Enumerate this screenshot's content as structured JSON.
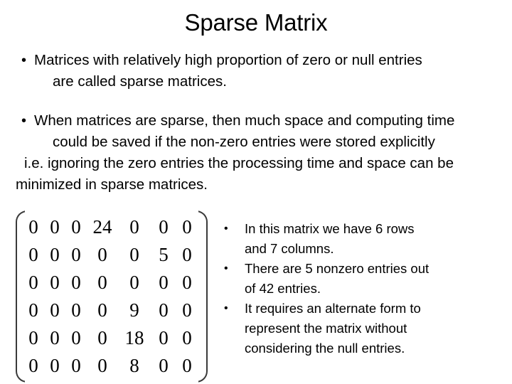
{
  "slide": {
    "title": "Sparse Matrix",
    "background_color": "#ffffff",
    "text_color": "#000000",
    "bracket_color": "#3a3a3a"
  },
  "paragraphs": [
    {
      "bullet": "•",
      "lines": [
        "Matrices with relatively high proportion of zero or null entries",
        "are called sparse matrices."
      ]
    },
    {
      "bullet": "•",
      "lines": [
        "When matrices are sparse, then much space and computing time",
        "could be saved if the non-zero entries were stored explicitly",
        "i.e. ignoring the zero entries the processing time and space can be",
        "minimized in sparse matrices."
      ]
    }
  ],
  "matrix": {
    "rows": 6,
    "cols": 7,
    "values": [
      [
        "0",
        "0",
        "0",
        "24",
        "0",
        "0",
        "0"
      ],
      [
        "0",
        "0",
        "0",
        "0",
        "0",
        "5",
        "0"
      ],
      [
        "0",
        "0",
        "0",
        "0",
        "0",
        "0",
        "0"
      ],
      [
        "0",
        "0",
        "0",
        "0",
        "9",
        "0",
        "0"
      ],
      [
        "0",
        "0",
        "0",
        "0",
        "18",
        "0",
        "0"
      ],
      [
        "0",
        "0",
        "0",
        "0",
        "8",
        "0",
        "0"
      ]
    ]
  },
  "notes": {
    "bullet": "•",
    "items": [
      {
        "lines": [
          "In this matrix we have 6 rows",
          "and 7 columns."
        ]
      },
      {
        "lines": [
          "There are 5 nonzero entries out",
          "of 42 entries."
        ]
      },
      {
        "lines": [
          "It requires an alternate form to",
          "represent the matrix without",
          "considering the null entries."
        ]
      }
    ]
  }
}
